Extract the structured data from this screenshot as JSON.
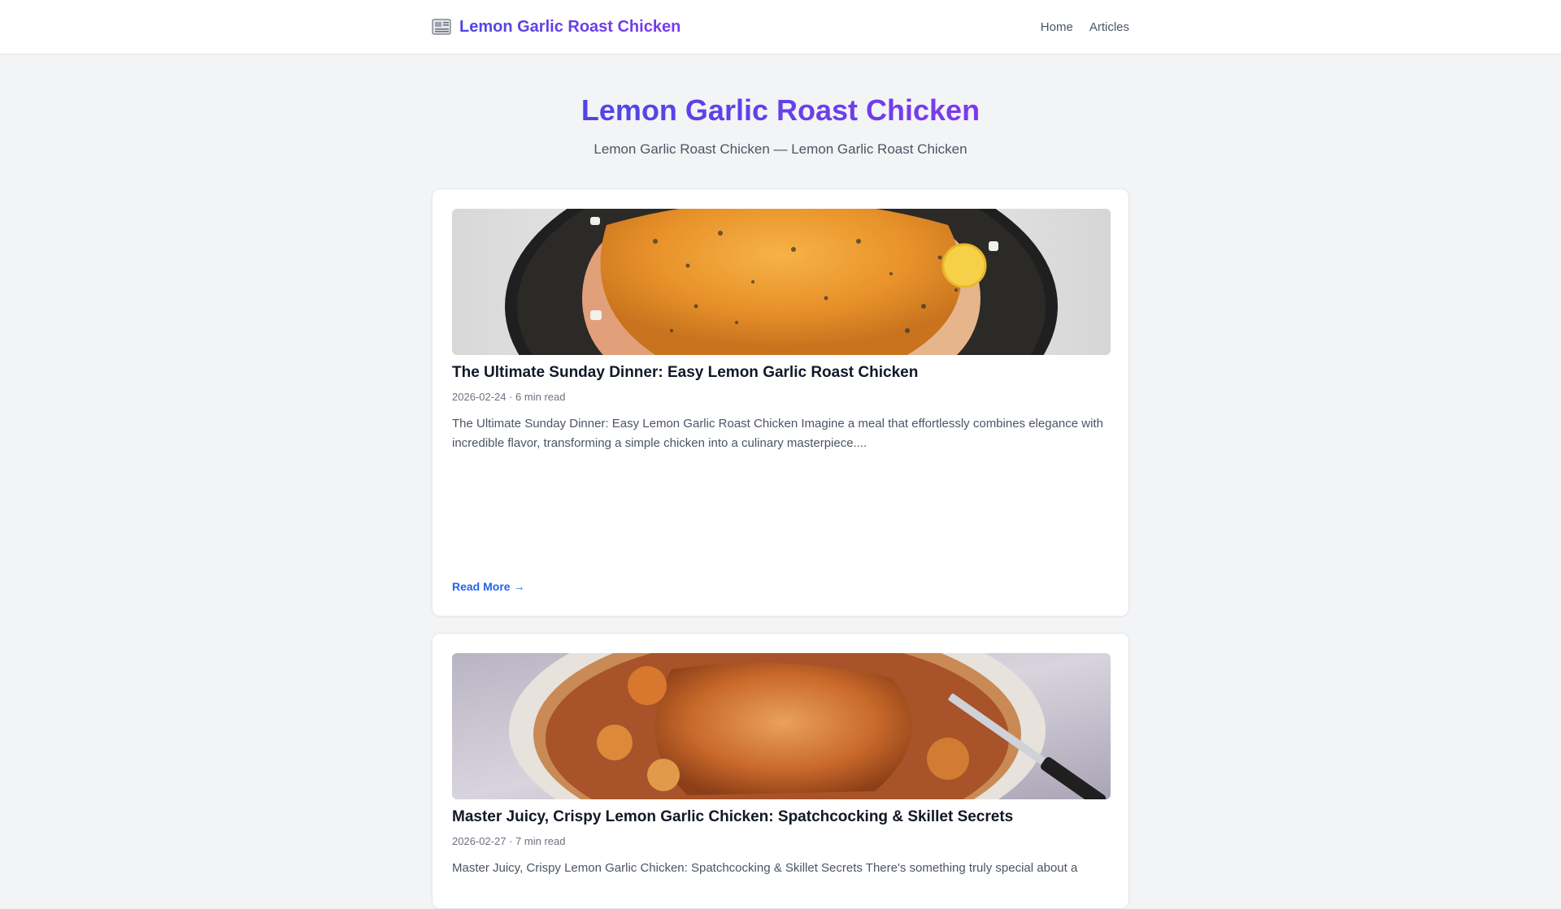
{
  "header": {
    "brand": "Lemon Garlic Roast Chicken",
    "brand_icon": "newspaper-icon",
    "nav": [
      {
        "label": "Home"
      },
      {
        "label": "Articles"
      }
    ]
  },
  "hero": {
    "title": "Lemon Garlic Roast Chicken",
    "subtitle": "Lemon Garlic Roast Chicken — Lemon Garlic Roast Chicken"
  },
  "articles": [
    {
      "title": "The Ultimate Sunday Dinner: Easy Lemon Garlic Roast Chicken",
      "meta": "2026-02-24 · 6 min read",
      "excerpt": "The Ultimate Sunday Dinner: Easy Lemon Garlic Roast Chicken Imagine a meal that effortlessly combines elegance with incredible flavor, transforming a simple chicken into a culinary masterpiece....",
      "read_more": "Read More →",
      "image": "roast-chicken-in-skillet-image"
    },
    {
      "title": "Master Juicy, Crispy Lemon Garlic Chicken: Spatchcocking & Skillet Secrets",
      "meta": "2026-02-27 · 7 min read",
      "excerpt": "Master Juicy, Crispy Lemon Garlic Chicken: Spatchcocking & Skillet Secrets There's something truly special about a",
      "image": "spatchcock-chicken-with-knife-image"
    }
  ],
  "colors": {
    "accent_start": "#4f46e5",
    "accent_end": "#7c3aed",
    "link": "#2563eb",
    "background": "#f3f4f6"
  }
}
